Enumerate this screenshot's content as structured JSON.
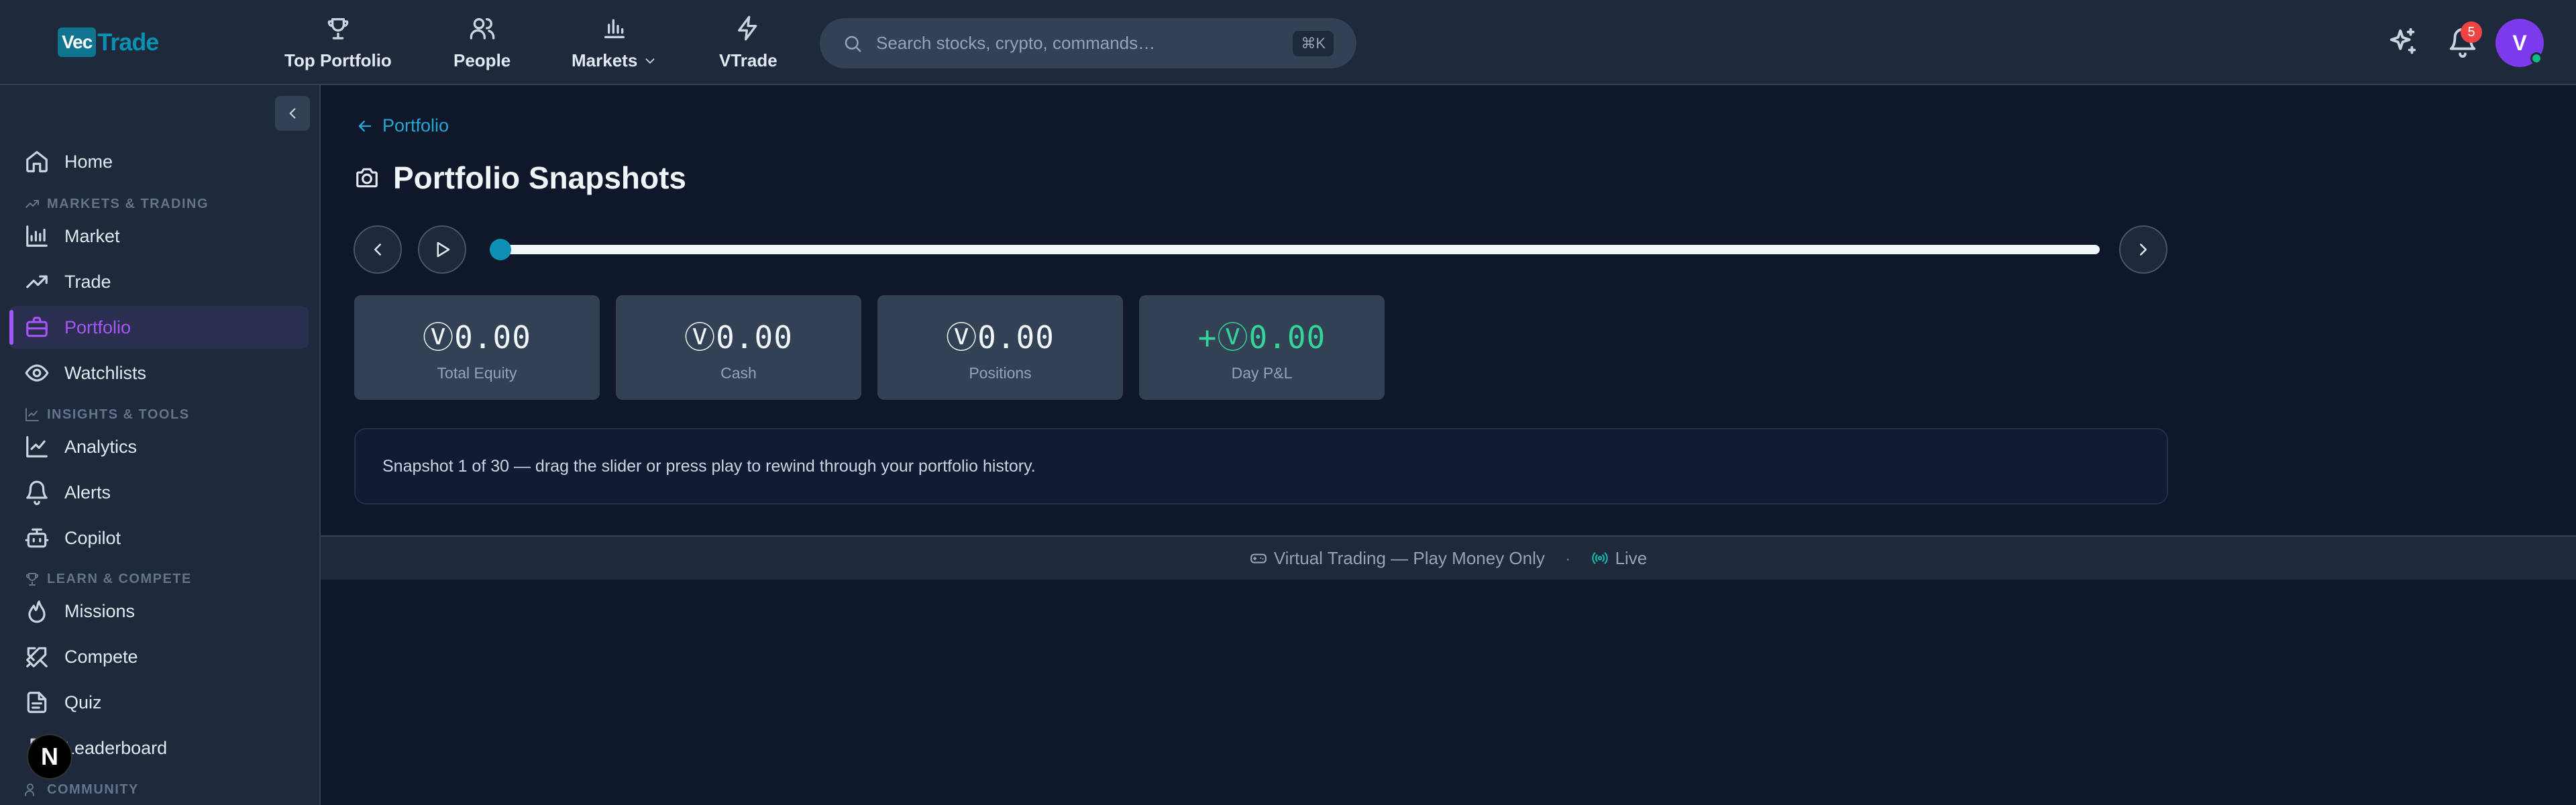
{
  "brand": {
    "part1": "Vec",
    "part2": "Trade"
  },
  "nav": [
    {
      "label": "Top Portfolio",
      "icon": "trophy-icon"
    },
    {
      "label": "People",
      "icon": "users-icon"
    },
    {
      "label": "Markets",
      "icon": "bar-chart-icon",
      "has_dropdown": true
    },
    {
      "label": "VTrade",
      "icon": "bolt-icon"
    }
  ],
  "search": {
    "placeholder": "Search stocks, crypto, commands…",
    "shortcut": "⌘K"
  },
  "header": {
    "notification_count": "5",
    "avatar_initial": "V"
  },
  "sidebar": {
    "sections": {
      "markets": "MARKETS & TRADING",
      "insights": "INSIGHTS & TOOLS",
      "learn": "LEARN & COMPETE",
      "community": "COMMUNITY"
    },
    "items": [
      {
        "label": "Home",
        "icon": "home-icon"
      },
      {
        "label": "Market",
        "icon": "bar-chart-icon"
      },
      {
        "label": "Trade",
        "icon": "trending-up-icon"
      },
      {
        "label": "Portfolio",
        "icon": "briefcase-icon",
        "active": true
      },
      {
        "label": "Watchlists",
        "icon": "eye-icon"
      },
      {
        "label": "Analytics",
        "icon": "line-chart-icon"
      },
      {
        "label": "Alerts",
        "icon": "bell-icon"
      },
      {
        "label": "Copilot",
        "icon": "bot-icon"
      },
      {
        "label": "Missions",
        "icon": "flame-icon"
      },
      {
        "label": "Compete",
        "icon": "swords-icon"
      },
      {
        "label": "Quiz",
        "icon": "document-icon"
      },
      {
        "label": "Leaderboard",
        "icon": "trophy-icon"
      }
    ]
  },
  "page": {
    "back_label": "Portfolio",
    "title": "Portfolio Snapshots",
    "slider": {
      "current": 1,
      "total": 30
    },
    "stats": [
      {
        "value": "Ⓥ0.00",
        "label": "Total Equity"
      },
      {
        "value": "Ⓥ0.00",
        "label": "Cash"
      },
      {
        "value": "Ⓥ0.00",
        "label": "Positions"
      },
      {
        "value": "+Ⓥ0.00",
        "label": "Day P&L",
        "positive": true
      }
    ],
    "info": "Snapshot 1 of 30 — drag the slider or press play to rewind through your portfolio history."
  },
  "footer": {
    "mode": "Virtual Trading — Play Money Only",
    "separator": "·",
    "status": "Live"
  },
  "colors": {
    "accent": "#a855f7",
    "link": "#22a7d0",
    "positive": "#34d399",
    "badge": "#ef4444",
    "avatar": "#7c3aed"
  }
}
